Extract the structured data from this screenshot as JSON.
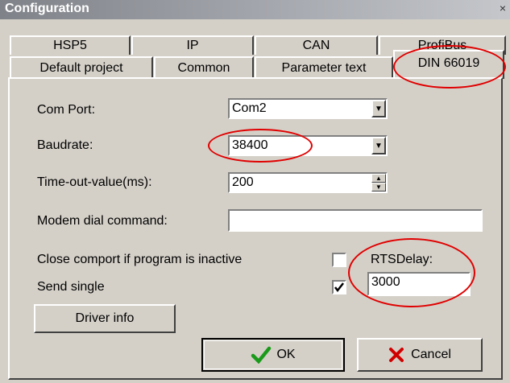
{
  "window": {
    "title": "Configuration",
    "close_glyph": "×"
  },
  "tabs_row1": [
    "HSP5",
    "IP",
    "CAN",
    "ProfiBus"
  ],
  "tabs_row2": [
    "Default project",
    "Common",
    "Parameter text",
    "DIN 66019"
  ],
  "form": {
    "com_port_label": "Com Port:",
    "com_port_value": "Com2",
    "baudrate_label": "Baudrate:",
    "baudrate_value": "38400",
    "timeout_label": "Time-out-value(ms):",
    "timeout_value": "200",
    "modem_label": "Modem dial command:",
    "modem_value": "",
    "close_comport_label": "Close comport if program is inactive",
    "close_comport_checked": false,
    "send_single_label": "Send single",
    "send_single_checked": true,
    "rts_delay_label": "RTSDelay:",
    "rts_delay_value": "3000",
    "driver_info_label": "Driver info"
  },
  "buttons": {
    "ok_label": "OK",
    "cancel_label": "Cancel"
  },
  "icons": {
    "ok": "green-checkmark-icon",
    "cancel": "red-x-icon"
  },
  "colors": {
    "annotation": "#e00000",
    "dialog": "#d4d0c8"
  }
}
